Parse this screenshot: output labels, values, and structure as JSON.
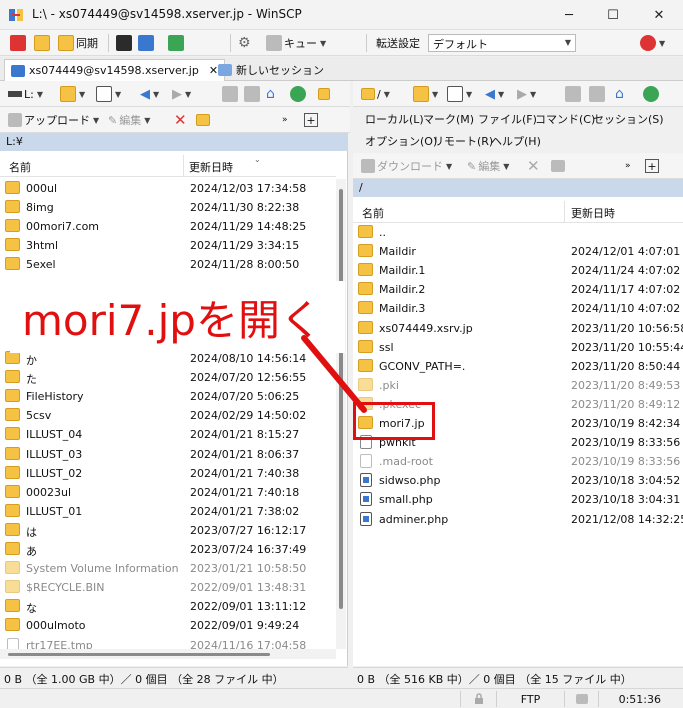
{
  "window": {
    "title": "L:\\ - xs074449@sv14598.xserver.jp - WinSCP",
    "minimize": "─",
    "maximize": "☐",
    "close": "✕"
  },
  "toolbar1": {
    "sync_label": "同期",
    "queue_label": "キュー",
    "transfer_settings_label": "転送設定",
    "transfer_preset": "デフォルト"
  },
  "tabs": [
    {
      "label": "xs074449@sv14598.xserver.jp",
      "close": "✕"
    },
    {
      "label": "新しいセッション"
    }
  ],
  "left": {
    "drive": "L:",
    "upload_label": "アップロード",
    "edit_label": "編集",
    "path": "L:¥",
    "col_name": "名前",
    "col_modified": "更新日時",
    "status": "0 B （全 1.00 GB 中）／ 0 個目 （全 28 ファイル 中）",
    "rows": [
      {
        "name": "000ul",
        "date": "2024/12/03  17:34:58",
        "type": "folder",
        "dim": false
      },
      {
        "name": "8img",
        "date": "2024/11/30  8:22:38",
        "type": "folder",
        "dim": false
      },
      {
        "name": "00mori7.com",
        "date": "2024/11/29  14:48:25",
        "type": "folder",
        "dim": false
      },
      {
        "name": "3html",
        "date": "2024/11/29  3:34:15",
        "type": "folder",
        "dim": false
      },
      {
        "name": "5exel",
        "date": "2024/11/28  8:00:50",
        "type": "folder",
        "dim": false
      },
      {
        "name": "か",
        "date": "2024/08/10  14:56:14",
        "type": "folder",
        "dim": false
      },
      {
        "name": "た",
        "date": "2024/07/20  12:56:55",
        "type": "folder",
        "dim": false
      },
      {
        "name": "FileHistory",
        "date": "2024/07/20  5:06:25",
        "type": "folder",
        "dim": false
      },
      {
        "name": "5csv",
        "date": "2024/02/29  14:50:02",
        "type": "folder",
        "dim": false
      },
      {
        "name": "ILLUST_04",
        "date": "2024/01/21  8:15:27",
        "type": "folder",
        "dim": false
      },
      {
        "name": "ILLUST_03",
        "date": "2024/01/21  8:06:37",
        "type": "folder",
        "dim": false
      },
      {
        "name": "ILLUST_02",
        "date": "2024/01/21  7:40:38",
        "type": "folder",
        "dim": false
      },
      {
        "name": "00023ul",
        "date": "2024/01/21  7:40:18",
        "type": "folder",
        "dim": false
      },
      {
        "name": "ILLUST_01",
        "date": "2024/01/21  7:38:02",
        "type": "folder",
        "dim": false
      },
      {
        "name": "は",
        "date": "2023/07/27  16:12:17",
        "type": "folder",
        "dim": false
      },
      {
        "name": "あ",
        "date": "2023/07/24  16:37:49",
        "type": "folder",
        "dim": false
      },
      {
        "name": "System Volume Information",
        "date": "2023/01/21  10:58:50",
        "type": "folder",
        "dim": true
      },
      {
        "name": "$RECYCLE.BIN",
        "date": "2022/09/01  13:48:31",
        "type": "folder",
        "dim": true
      },
      {
        "name": "な",
        "date": "2022/09/01  13:11:12",
        "type": "folder",
        "dim": false
      },
      {
        "name": "000ulmoto",
        "date": "2022/09/01  9:49:24",
        "type": "folder",
        "dim": false
      },
      {
        "name": "rtr17EE.tmp",
        "date": "2024/11/16  17:04:58",
        "type": "file",
        "dim": true
      }
    ]
  },
  "right": {
    "path_short": "/",
    "menu": [
      "ローカル(L)",
      "マーク(M)",
      "ファイル(F)",
      "コマンド(C)",
      "セッション(S)",
      "オプション(O)",
      "リモート(R)",
      "ヘルプ(H)"
    ],
    "download_label": "ダウンロード",
    "edit_label": "編集",
    "path": "/",
    "col_name": "名前",
    "col_modified": "更新日時",
    "status": "0 B （全 516 KB 中）／ 0 個目 （全 15 ファイル 中）",
    "rows": [
      {
        "name": "..",
        "date": "",
        "type": "updir",
        "dim": false
      },
      {
        "name": "Maildir",
        "date": "2024/12/01 4:07:01",
        "type": "folder",
        "dim": false
      },
      {
        "name": "Maildir.1",
        "date": "2024/11/24 4:07:02",
        "type": "folder",
        "dim": false
      },
      {
        "name": "Maildir.2",
        "date": "2024/11/17 4:07:02",
        "type": "folder",
        "dim": false
      },
      {
        "name": "Maildir.3",
        "date": "2024/11/10 4:07:02",
        "type": "folder",
        "dim": false
      },
      {
        "name": "xs074449.xsrv.jp",
        "date": "2023/11/20 10:56:58",
        "type": "folder",
        "dim": false
      },
      {
        "name": "ssl",
        "date": "2023/11/20 10:55:44",
        "type": "folder",
        "dim": false
      },
      {
        "name": "GCONV_PATH=.",
        "date": "2023/11/20 8:50:44",
        "type": "folder",
        "dim": false
      },
      {
        "name": ".pki",
        "date": "2023/11/20 8:49:53",
        "type": "folder",
        "dim": true
      },
      {
        "name": ".pkexec",
        "date": "2023/11/20 8:49:12",
        "type": "folder",
        "dim": true
      },
      {
        "name": "mori7.jp",
        "date": "2023/10/19 8:42:34",
        "type": "folder",
        "dim": false
      },
      {
        "name": "pwnkit",
        "date": "2023/10/19 8:33:56",
        "type": "file",
        "dim": false
      },
      {
        "name": ".mad-root",
        "date": "2023/10/19 8:33:56",
        "type": "file",
        "dim": true
      },
      {
        "name": "sidwso.php",
        "date": "2023/10/18 3:04:52",
        "type": "php",
        "dim": false
      },
      {
        "name": "small.php",
        "date": "2023/10/18 3:04:31",
        "type": "php",
        "dim": false
      },
      {
        "name": "adminer.php",
        "date": "2021/12/08 14:32:25",
        "type": "php",
        "dim": false
      }
    ]
  },
  "bottom": {
    "protocol": "FTP",
    "elapsed": "0:51:36"
  },
  "annotation": {
    "text": "mori7.jpを開く"
  },
  "colors": {
    "annotation_red": "#e01010",
    "path_bar": "#c9d8ea",
    "folder": "#f5c243"
  }
}
